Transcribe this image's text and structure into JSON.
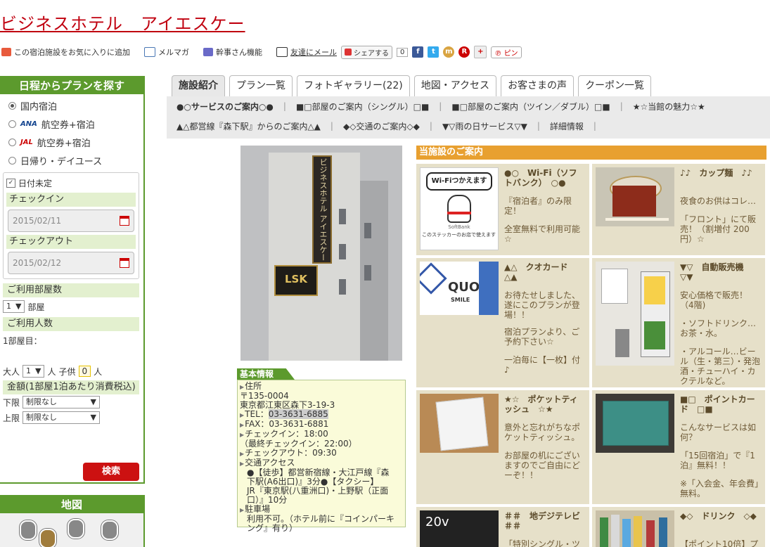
{
  "header": {
    "title": "ビジネスホテル　アイエスケー",
    "favorite": "この宿泊施設をお気に入りに追加",
    "mailmag": "メルマガ",
    "kanji": "幹事さん機能",
    "friend_mail": "友達にメール",
    "share": "シェアする",
    "share_count": "0",
    "pin": "ピン"
  },
  "sidebar": {
    "heading": "日程からプランを探す",
    "options": [
      {
        "label": "国内宿泊",
        "selected": true
      },
      {
        "label": "航空券+宿泊",
        "brand": "ANA",
        "selected": false
      },
      {
        "label": "航空券+宿泊",
        "brand": "JAL",
        "selected": false
      },
      {
        "label": "日帰り・デイユース",
        "selected": false
      }
    ],
    "undated": "日付未定",
    "checkin_label": "チェックイン",
    "checkin_value": "2015/02/11",
    "checkout_label": "チェックアウト",
    "checkout_value": "2015/02/12",
    "rooms_label": "ご利用部屋数",
    "rooms_value": "1",
    "rooms_unit": "部屋",
    "people_label": "ご利用人数",
    "room1": "1部屋目：",
    "adult_label": "大人",
    "adult_value": "1",
    "adult_unit": "人",
    "child_label": "子供",
    "child_value": "0",
    "child_unit": "人",
    "price_label": "金額(1部屋1泊あたり消費税込)",
    "lower_label": "下限",
    "lower_value": "制限なし",
    "upper_label": "上限",
    "upper_value": "制限なし",
    "search": "検索",
    "map_heading": "地図"
  },
  "tabs": [
    "施設紹介",
    "プラン一覧",
    "フォトギャラリー(22)",
    "地図・アクセス",
    "お客さまの声",
    "クーポン一覧"
  ],
  "subnav": {
    "row1": [
      "●○サービスのご案内○●",
      "■□部屋のご案内（シングル）□■",
      "■□部屋のご案内（ツイン／ダブル）□■",
      "★☆当館の魅力☆★"
    ],
    "row2": [
      "▲△都営線『森下駅』からのご案内△▲",
      "◆◇交通のご案内◇◆",
      "▼▽雨の日サービス▽▼",
      "詳細情報"
    ]
  },
  "photo": {
    "sign_text": "ビジネスホテル アイエスケー",
    "logo": "LSK"
  },
  "basic_info": {
    "heading": "基本情報",
    "address_label": "住所",
    "postal": "〒135-0004",
    "address": "東京都江東区森下3-19-3",
    "tel_label": "TEL：",
    "tel": "03-3631-6885",
    "fax": "FAX：03-3631-6881",
    "checkin": "チェックイン：18:00",
    "last_checkin": "（最終チェックイン：22:00）",
    "checkout": "チェックアウト：09:30",
    "access_label": "交通アクセス",
    "access1": "●【徒歩】都営新宿線・大江戸線『森",
    "access2": "下駅(A6出口)』3分●【タクシー】",
    "access3": "JR『東京駅(八重洲口)・上野駅（正面",
    "access4": "口）』10分",
    "parking_label": "駐車場",
    "parking1": "利用不可。（ホテル前に『コインパーキ",
    "parking2": "ング』有り）"
  },
  "guide": {
    "heading": "当施設のご案内",
    "cards": [
      {
        "title": "●○　Wi-Fi（ソフトバンク）　○●",
        "text": [
          "『宿泊者』のみ限定！",
          "全室無料で利用可能☆"
        ],
        "img": "wifi",
        "caption": "このステッカーのお店で使えます",
        "wifi": "Wi-Fiつかえます",
        "brand": "SoftBank"
      },
      {
        "title": "♪♪　カップ麺　♪♪",
        "text": [
          "夜食のお供はコレ…",
          "「フロント」にて販売！（割増付 200円）☆"
        ],
        "img": "cup"
      },
      {
        "title": "▲△　クオカード　△▲",
        "text": [
          "お待たせしました、遂にこのプランが登場！！",
          "宿泊プランより、ご予約下さい☆",
          "一泊毎に【一枚】付♪"
        ],
        "img": "quo",
        "quo": "QUO",
        "quo_sub": "SMILE"
      },
      {
        "title": "▼▽　自動販売機　▽▼",
        "text": [
          "安心価格で販売！（4階)",
          "・ソフトドリンク…お茶・水。",
          "・アルコール…ビール（生・第三）・発泡酒・チューハイ・カクテルなど。"
        ],
        "img": "vending"
      },
      {
        "title": "★☆　ポケットティッシュ　☆★",
        "text": [
          "意外と忘れがちなポケットティッシュ。",
          "お部屋の机にございますのでご自由にどーぞ！！"
        ],
        "img": "tissue"
      },
      {
        "title": "■□　ポイントカード　□■",
        "text": [
          "こんなサービスは如何？",
          "「15回宿泊」で『1泊』無料！！",
          "※「入会金、年会費」無料。"
        ],
        "img": "card"
      },
      {
        "title": "＃＃　地デジテレビ　＃＃",
        "text": [
          "「特別シングル・ツ"
        ],
        "img": "tv",
        "tv": "20v"
      },
      {
        "title": "◆◇　ドリンク　◇◆",
        "text": [
          "【ポイント10倍】プ"
        ],
        "img": "drinks"
      }
    ]
  }
}
